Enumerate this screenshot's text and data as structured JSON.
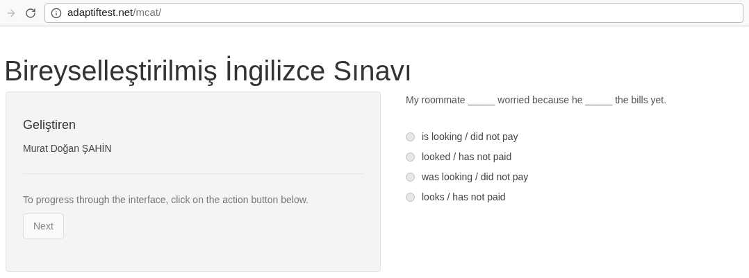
{
  "browser": {
    "url_host": "adaptiftest.net",
    "url_path": "/mcat/"
  },
  "title": "Bireyselleştirilmiş İngilizce Sınavı",
  "panel": {
    "heading": "Geliştiren",
    "author": "Murat Doğan ŞAHİN",
    "instructions": "To progress through the interface, click on the action button below.",
    "button": {
      "label": "Next",
      "disabled": true
    }
  },
  "question": {
    "prompt": "My roommate _____ worried because he _____ the bills yet.",
    "options": [
      {
        "label": "is looking / did not pay",
        "selected": false
      },
      {
        "label": "looked / has not paid",
        "selected": false
      },
      {
        "label": "was looking / did not pay",
        "selected": false
      },
      {
        "label": "looks / has not paid",
        "selected": false
      }
    ]
  }
}
